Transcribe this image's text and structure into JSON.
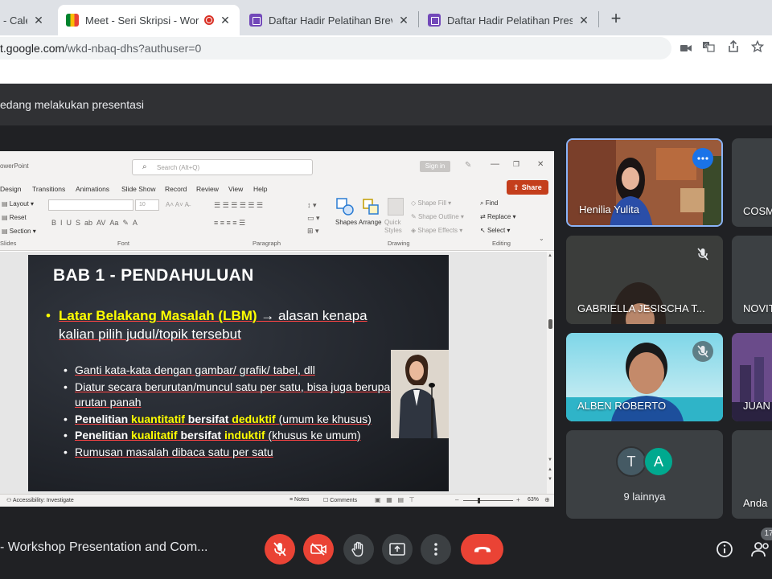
{
  "browser": {
    "tabs": [
      {
        "title": "- Calen",
        "type": "calendar"
      },
      {
        "title": "Meet - Seri Skripsi - Works",
        "type": "meet",
        "recording": true
      },
      {
        "title": "Daftar Hadir Pelatihan Brevet A",
        "type": "forms"
      },
      {
        "title": "Daftar Hadir Pelatihan Presentas",
        "type": "forms"
      }
    ],
    "close_glyph": "✕",
    "new_tab_glyph": "+",
    "url_host": "t.google.com",
    "url_path": "/wkd-nbaq-dhs?authuser=0",
    "toolbar_icons": [
      "camera-icon",
      "translate-icon",
      "share-icon",
      "star-icon"
    ]
  },
  "meet": {
    "presenting_banner": "edang melakukan presentasi",
    "meeting_title": "- Workshop Presentation and Com...",
    "people_count": "17",
    "participants": [
      {
        "name": "Henilia Yulita",
        "active_speaker": true
      },
      {
        "name": "COSM"
      },
      {
        "name": "GABRIELLA JESISCHA T...",
        "muted": true
      },
      {
        "name": "NOVIT"
      },
      {
        "name": "ALBEN ROBERTO",
        "muted": true
      },
      {
        "name": "JUAN"
      },
      {
        "name": "9 lainnya",
        "avatars": [
          "T",
          "A"
        ]
      },
      {
        "name": "Anda"
      }
    ],
    "colors": {
      "end_call": "#ea4335",
      "active_border": "#8ab4f8",
      "avatar_bg": "#3c4043",
      "avatar_alt": "#00a98f"
    }
  },
  "ppt": {
    "app_title": "owerPoint",
    "search_placeholder": "Search (Alt+Q)",
    "sign_in": "Sign in",
    "share_label": "Share",
    "ribbon_tabs": [
      "Design",
      "Transitions",
      "Animations",
      "Slide Show",
      "Record",
      "Review",
      "View",
      "Help"
    ],
    "slides_group": [
      "Layout",
      "Reset",
      "Section"
    ],
    "group_labels": [
      "Slides",
      "Font",
      "Paragraph",
      "Drawing",
      "Editing"
    ],
    "font_size": "10",
    "drawing": {
      "shapes": "Shapes",
      "arrange": "Arrange",
      "quick_styles": "Quick Styles",
      "fill": "Shape Fill",
      "outline": "Shape Outline",
      "effects": "Shape Effects"
    },
    "editing": [
      "Find",
      "Replace",
      "Select"
    ],
    "status": {
      "accessibility": "Accessibility: Investigate",
      "notes": "Notes",
      "comments": "Comments",
      "zoom": "63%"
    }
  },
  "slide": {
    "title": "BAB 1 - PENDAHULUAN",
    "main_highlight": "Latar Belakang Masalah (LBM)",
    "main_rest": " → alasan kenapa kalian pilih judul/topik tersebut",
    "bullets": [
      {
        "parts": [
          {
            "t": "Ganti kata-kata dengan gambar/ grafik/ tabel, dll"
          }
        ]
      },
      {
        "parts": [
          {
            "t": "Diatur secara berurutan/muncul satu per satu, bisa juga berupa urutan panah"
          }
        ]
      },
      {
        "parts": [
          {
            "t": "Penelitian ",
            "b": true
          },
          {
            "t": "kuantitatif",
            "b": true,
            "y": true
          },
          {
            "t": " bersifat ",
            "b": true
          },
          {
            "t": "deduktif",
            "b": true,
            "y": true
          },
          {
            "t": " (umum ke khusus)"
          }
        ]
      },
      {
        "parts": [
          {
            "t": "Penelitian ",
            "b": true
          },
          {
            "t": "kualitatif",
            "b": true,
            "y": true
          },
          {
            "t": " bersifat ",
            "b": true
          },
          {
            "t": "induktif",
            "b": true,
            "y": true
          },
          {
            "t": " (khusus ke umum)"
          }
        ]
      },
      {
        "parts": [
          {
            "t": "Rumusan masalah dibaca satu per satu"
          }
        ]
      }
    ]
  }
}
